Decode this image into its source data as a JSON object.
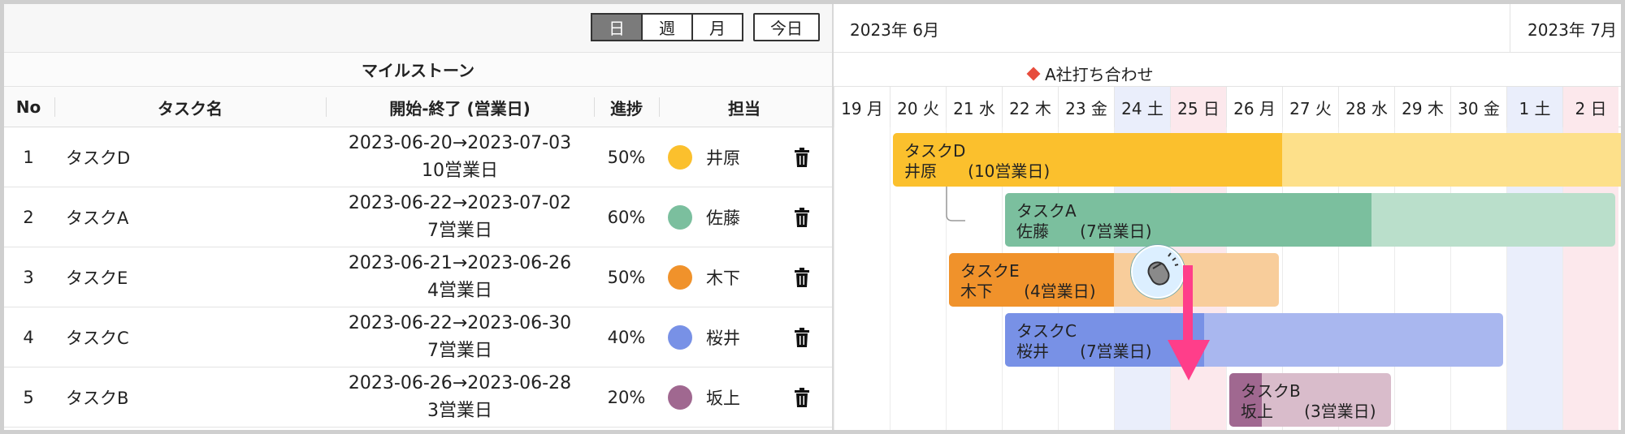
{
  "toolbar": {
    "view_buttons": [
      {
        "label": "日",
        "active": true
      },
      {
        "label": "週",
        "active": false
      },
      {
        "label": "月",
        "active": false
      }
    ],
    "today_label": "今日"
  },
  "milestone_header": "マイルストーン",
  "columns": {
    "no": "No",
    "name": "タスク名",
    "range": "開始-終了 (営業日)",
    "progress": "進捗",
    "assignee": "担当"
  },
  "tasks": [
    {
      "no": "1",
      "name": "タスクD",
      "range": "2023-06-20→2023-07-03",
      "days": "10営業日",
      "progress_label": "50%",
      "progress": 0.5,
      "assignee": "井原",
      "color": "#fbc02d",
      "light": "#fde08a"
    },
    {
      "no": "2",
      "name": "タスクA",
      "range": "2023-06-22→2023-07-02",
      "days": "7営業日",
      "progress_label": "60%",
      "progress": 0.6,
      "assignee": "佐藤",
      "color": "#7bbf9e",
      "light": "#badfcb"
    },
    {
      "no": "3",
      "name": "タスクE",
      "range": "2023-06-21→2023-06-26",
      "days": "4営業日",
      "progress_label": "50%",
      "progress": 0.5,
      "assignee": "木下",
      "color": "#f0922b",
      "light": "#f8cd9b"
    },
    {
      "no": "4",
      "name": "タスクC",
      "range": "2023-06-22→2023-06-30",
      "days": "7営業日",
      "progress_label": "40%",
      "progress": 0.4,
      "assignee": "桜井",
      "color": "#7891e6",
      "light": "#a9b7ef"
    },
    {
      "no": "5",
      "name": "タスクB",
      "range": "2023-06-26→2023-06-28",
      "days": "3営業日",
      "progress_label": "20%",
      "progress": 0.2,
      "assignee": "坂上",
      "color": "#a06890",
      "light": "#d9bccb"
    }
  ],
  "gantt": {
    "months": [
      "2023年 6月",
      "2023年 7月"
    ],
    "milestone_label": "A社打ち合わせ",
    "milestone_color": "#e74c3c",
    "days": [
      {
        "label": "19 月",
        "type": "weekday"
      },
      {
        "label": "20 火",
        "type": "weekday"
      },
      {
        "label": "21 水",
        "type": "weekday"
      },
      {
        "label": "22 木",
        "type": "weekday"
      },
      {
        "label": "23 金",
        "type": "weekday"
      },
      {
        "label": "24 土",
        "type": "saturday"
      },
      {
        "label": "25 日",
        "type": "sunday"
      },
      {
        "label": "26 月",
        "type": "weekday"
      },
      {
        "label": "27 火",
        "type": "weekday"
      },
      {
        "label": "28 水",
        "type": "weekday"
      },
      {
        "label": "29 木",
        "type": "weekday"
      },
      {
        "label": "30 金",
        "type": "weekday"
      },
      {
        "label": "1 土",
        "type": "saturday"
      },
      {
        "label": "2 日",
        "type": "sunday"
      }
    ],
    "saturday_color": "#eaeefb",
    "sunday_color": "#fce8ec",
    "drag_arrow_color": "#ff3e8a"
  }
}
